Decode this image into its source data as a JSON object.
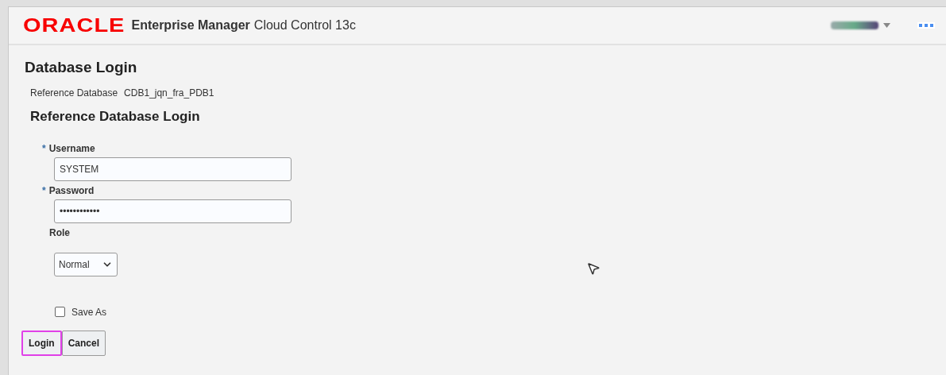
{
  "header": {
    "logo": "ORACLE",
    "product": "Enterprise Manager",
    "edition": "Cloud Control 13c"
  },
  "page_title": "Database Login",
  "reference": {
    "label": "Reference Database",
    "value": "CDB1_jqn_fra_PDB1"
  },
  "section_title": "Reference Database Login",
  "fields": [
    {
      "label": "Username",
      "required": true,
      "kind": "text",
      "value": "SYSTEM"
    },
    {
      "label": "Password",
      "required": true,
      "kind": "text",
      "value": "••••••••••••"
    },
    {
      "label": "Role",
      "required": false,
      "kind": "select",
      "value": "Normal"
    }
  ],
  "required_mark": "*",
  "save_as": {
    "label": "Save As",
    "checked": false
  },
  "buttons": [
    {
      "label": "Login",
      "highlighted": true
    },
    {
      "label": "Cancel",
      "highlighted": false
    }
  ]
}
